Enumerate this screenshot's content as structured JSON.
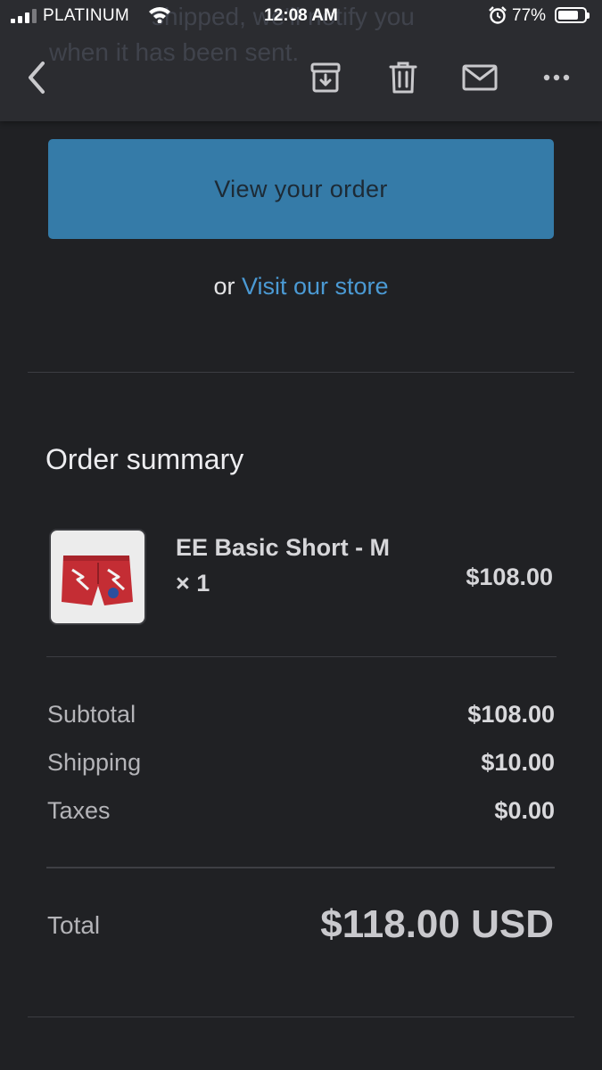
{
  "status_bar": {
    "carrier": "PLATINUM",
    "time": "12:08 AM",
    "battery_percent": "77%",
    "battery_level": 0.77,
    "icons": [
      "signal-icon",
      "wifi-icon",
      "alarm-icon",
      "battery-icon"
    ]
  },
  "background_text": {
    "line1": "shipped, we'll notify you",
    "line2": "when it has been sent."
  },
  "toolbar": {
    "icons": [
      "back-chevron-icon",
      "archive-icon",
      "trash-icon",
      "mail-icon",
      "more-icon"
    ]
  },
  "email": {
    "view_order_label": "View your order",
    "or_text": "or",
    "visit_store_label": "Visit our store",
    "order_summary_title": "Order summary",
    "line_item": {
      "name": "EE Basic Short - M × 1",
      "price": "$108.00",
      "thumbnail": "red-shorts-product-image"
    },
    "totals": {
      "subtotal_label": "Subtotal",
      "subtotal_value": "$108.00",
      "shipping_label": "Shipping",
      "shipping_value": "$10.00",
      "taxes_label": "Taxes",
      "taxes_value": "$0.00",
      "total_label": "Total",
      "total_value": "$118.00 USD"
    }
  },
  "colors": {
    "background": "#202124",
    "toolbar": "#2b2c30",
    "button": "#357ba8",
    "link": "#4b9ad4"
  }
}
